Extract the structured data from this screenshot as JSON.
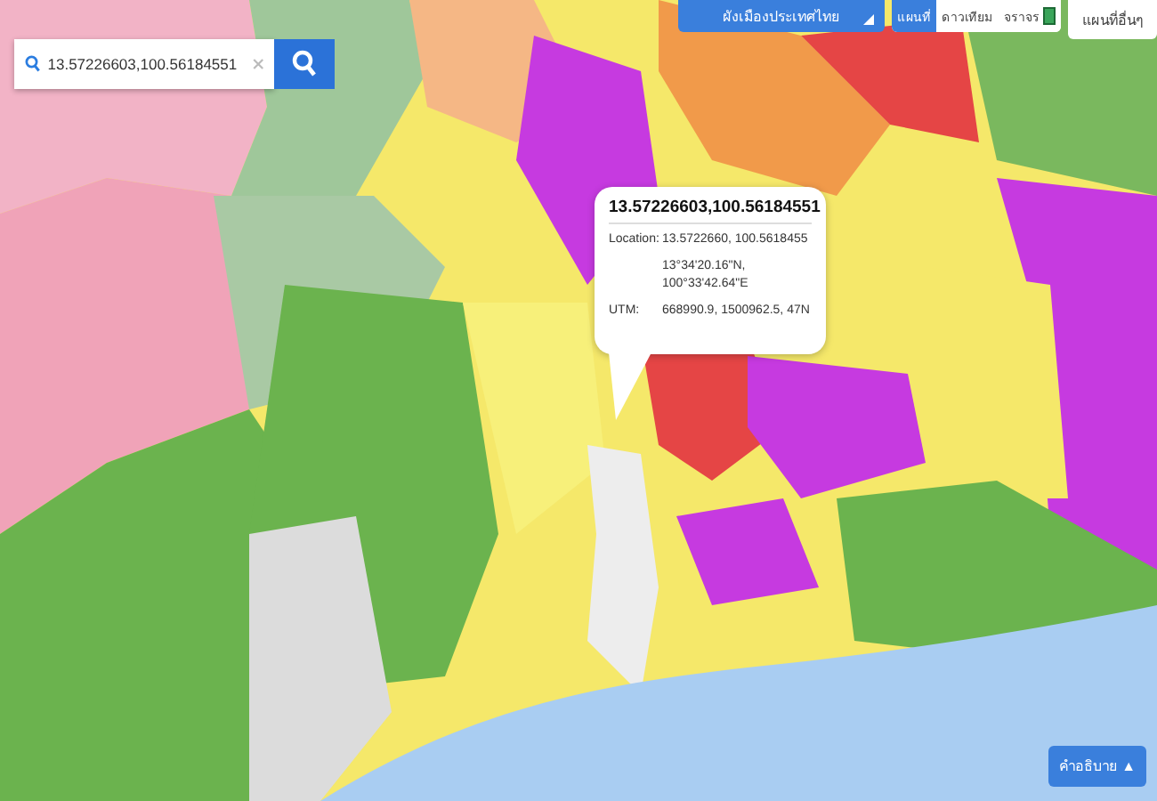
{
  "search": {
    "value": "13.57226603,100.56184551"
  },
  "layer_dropdown": {
    "label": "ผังเมืองประเทศไทย"
  },
  "map_types": [
    {
      "label": "แผนที่",
      "selected": true
    },
    {
      "label": "ดาวเทียม",
      "selected": false
    },
    {
      "label": "จราจร",
      "selected": false,
      "kind": "traffic"
    }
  ],
  "other_maps": {
    "label": "แผนที่อื่นๆ"
  },
  "popup": {
    "title": "13.57226603,100.56184551",
    "rows": [
      {
        "label": "Location:",
        "lines": [
          "13.5722660, 100.5618455"
        ]
      },
      {
        "lines": [
          "13°34'20.16\"N,",
          "100°33'42.64\"E"
        ]
      },
      {
        "label": "UTM:",
        "lines": [
          "668990.9, 1500962.5, 47N"
        ]
      }
    ]
  },
  "legend_button": {
    "label": "คำอธิบาย",
    "caret": "▲"
  }
}
